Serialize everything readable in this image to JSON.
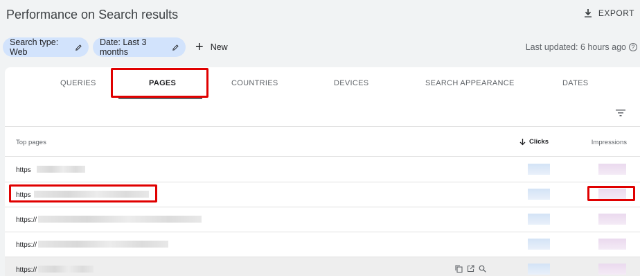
{
  "header": {
    "title": "Performance on Search results",
    "export_label": "EXPORT"
  },
  "filters": {
    "search_type": "Search type: Web",
    "date": "Date: Last 3 months",
    "new_label": "New",
    "last_updated": "Last updated: 6 hours ago"
  },
  "tabs": [
    "QUERIES",
    "PAGES",
    "COUNTRIES",
    "DEVICES",
    "SEARCH APPEARANCE",
    "DATES"
  ],
  "active_tab": "PAGES",
  "table": {
    "headers": {
      "pages": "Top pages",
      "clicks": "Clicks",
      "impressions": "Impressions"
    },
    "sort_column": "Clicks",
    "rows": [
      {
        "url": "https"
      },
      {
        "url": "https"
      },
      {
        "url": "https://"
      },
      {
        "url": "https://"
      },
      {
        "url": "https://"
      }
    ]
  },
  "colors": {
    "highlight": "#e00000",
    "chip_bg": "#d2e3fc"
  },
  "icons": [
    "download-icon",
    "pencil-icon",
    "plus-icon",
    "help-icon",
    "filter-icon",
    "arrow-down-icon",
    "copy-icon",
    "open-in-new-icon",
    "search-icon"
  ]
}
